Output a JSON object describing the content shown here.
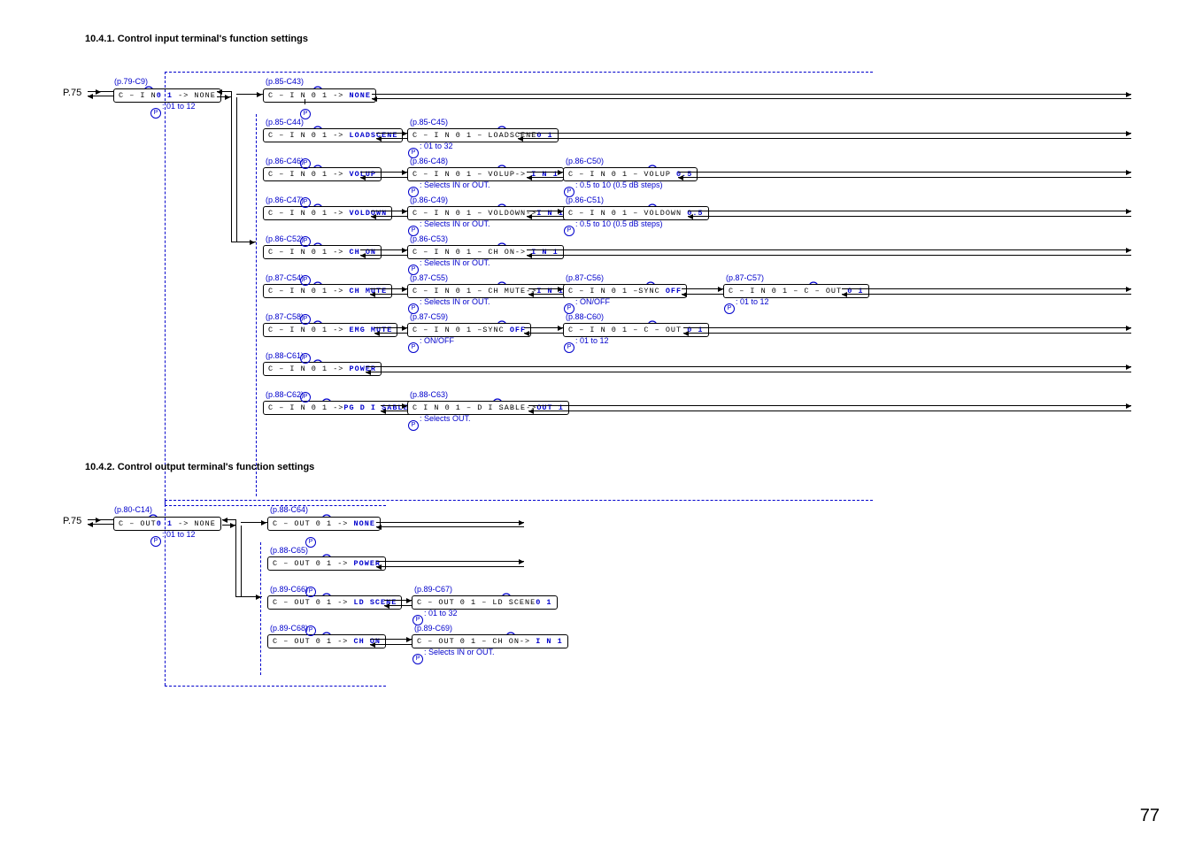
{
  "section1_title": "10.4.1. Control input terminal's function settings",
  "section2_title": "10.4.2. Control output terminal's function settings",
  "page_label": "P.75",
  "page_number": "77",
  "refs": {
    "c9": "(p.79-C9)",
    "c43": "(p.85-C43)",
    "c44": "(p.85-C44)",
    "c45": "(p.85-C45)",
    "c46": "(p.86-C46)",
    "c47": "(p.86-C47)",
    "c48": "(p.86-C48)",
    "c49": "(p.86-C49)",
    "c50": "(p.86-C50)",
    "c51": "(p.86-C51)",
    "c52": "(p.86-C52)",
    "c53": "(p.86-C53)",
    "c54": "(p.87-C54)",
    "c55": "(p.87-C55)",
    "c56": "(p.87-C56)",
    "c57": "(p.87-C57)",
    "c58": "(p.87-C58)",
    "c59": "(p.87-C59)",
    "c60": "(p.88-C60)",
    "c61": "(p.88-C61)",
    "c62": "(p.88-C62)",
    "c63": "(p.88-C63)",
    "c14": "(p.80-C14)",
    "c64": "(p.88-C64)",
    "c65": "(p.88-C65)",
    "c66": "(p.89-C66)",
    "c67": "(p.89-C67)",
    "c68": "(p.89-C68)",
    "c69": "(p.89-C69)"
  },
  "boxes": {
    "b_c9_pre": "C – I N",
    "b_c9_blink": "0 1",
    "b_c9_post": "  ->   NONE",
    "b_c43_pre": "C – I N 0 1   ->   ",
    "b_c43_blink": "NONE",
    "b_c44_pre": "C – I N 0 1   -> ",
    "b_c44_blink": "LOADSCENE",
    "b_c45_pre": "C – I N 0 1 – LOADSCENE",
    "b_c45_blink": "0 1",
    "b_c46_pre": "C – I N 0 1   ->   ",
    "b_c46_blink": "VOLUP",
    "b_c48_pre": "C – I N 0 1 – VOLUP->   ",
    "b_c48_blink": "I N 1",
    "b_c50_pre": "C – I N 0 1 – VOLUP      ",
    "b_c50_blink": "0.5",
    "b_c47_pre": "C – I N 0 1   ->   ",
    "b_c47_blink": "VOLDOWN",
    "b_c49_pre": "C – I N 0 1 – VOLDOWN->",
    "b_c49_blink": "I N 1",
    "b_c51_pre": "C – I N 0 1 – VOLDOWN   ",
    "b_c51_blink": "0.5",
    "b_c52_pre": "C – I N 0 1   ->   ",
    "b_c52_blink": "CH  ON",
    "b_c53_pre": "C – I N 0 1 – CH   ON->  ",
    "b_c53_blink": "I N 1",
    "b_c54_pre": "C – I N 0 1   ->   ",
    "b_c54_blink": "CH  MUTE",
    "b_c55_pre": "C – I N 0 1 – CH   MUTE->",
    "b_c55_blink": "I N 1",
    "b_c56_pre": "C – I N 0 1 –SYNC         ",
    "b_c56_blink": "OFF",
    "b_c57_pre": "C – I N 0 1 – C – OUT     ",
    "b_c57_blink": "0 1",
    "b_c58_pre": "C – I N 0 1   ->   ",
    "b_c58_blink": "EMG  MUTE",
    "b_c59_pre": "C – I N 0 1 –SYNC        ",
    "b_c59_blink": "OFF",
    "b_c60_pre": "C – I N 0 1 – C – OUT      ",
    "b_c60_blink": "0 1",
    "b_c61_pre": "C – I N 0 1   ->   ",
    "b_c61_blink": "POWER",
    "b_c62_pre": "C – I N 0 1   ->",
    "b_c62_blink": "PG  D I SABLE",
    "b_c63_pre": "C I N 0 1 – D I SABLE->",
    "b_c63_blink": "OUT 1",
    "b_c14_pre": "C – OUT",
    "b_c14_blink": "0 1",
    "b_c14_post": " ->   NONE",
    "b_c64_pre": "C – OUT 0 1   ->   ",
    "b_c64_blink": "NONE",
    "b_c65_pre": "C – OUT 0 1   ->   ",
    "b_c65_blink": "POWER",
    "b_c66_pre": "C – OUT 0 1   ->  ",
    "b_c66_blink": "LD  SCENE",
    "b_c67_pre": "C – OUT 0 1 – LD  SCENE",
    "b_c67_blink": "0 1",
    "b_c68_pre": "C – OUT 0 1   ->   ",
    "b_c68_blink": "CH  ON",
    "b_c69_pre": "C – OUT 0 1 – CH   ON->  ",
    "b_c69_blink": "I N 1"
  },
  "notes": {
    "n_01_12": ": 01 to 12",
    "n_01_32": ": 01 to 32",
    "n_inout": ": Selects IN or OUT.",
    "n_out": ": Selects OUT.",
    "n_db": ": 0.5 to 10 (0.5 dB steps)",
    "n_onoff": ": ON/OFF"
  }
}
